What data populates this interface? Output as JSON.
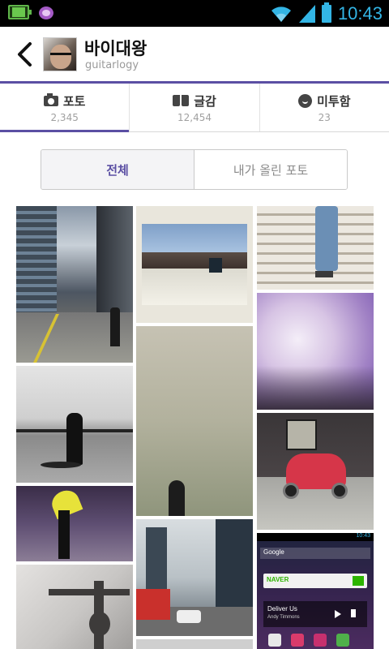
{
  "status_bar": {
    "time": "10:43",
    "icons": [
      "battery-saver-icon",
      "kakaotalk-icon",
      "wifi-icon",
      "signal-icon",
      "battery-icon"
    ],
    "accent_color": "#33b5e5"
  },
  "header": {
    "back_icon": "chevron-left-icon",
    "title": "바이대왕",
    "subtitle": "guitarlogy",
    "accent_color": "#5b4fa3"
  },
  "tabs": [
    {
      "icon": "camera-icon",
      "label": "포토",
      "count": "2,345",
      "active": true
    },
    {
      "icon": "book-icon",
      "label": "글감",
      "count": "12,454",
      "active": false
    },
    {
      "icon": "speech-bubble-icon",
      "label": "미투함",
      "count": "23",
      "active": false
    }
  ],
  "filter": {
    "options": [
      "전체",
      "내가 올린 포토"
    ],
    "selected": "전체"
  },
  "photos": {
    "grid": [
      "street-buildings",
      "house-hill",
      "stairs-walker",
      "cherry-blossom",
      "seaside-walker",
      "foggy-person",
      "red-scooter",
      "yellow-umbrella",
      "wall-shadow",
      "city-traffic",
      "android-homescreen"
    ],
    "phone_preview": {
      "time": "10:43",
      "search_label": "Google",
      "naver_label": "NAVER",
      "song_title": "Deliver Us",
      "song_artist": "Andy Timmons"
    }
  }
}
